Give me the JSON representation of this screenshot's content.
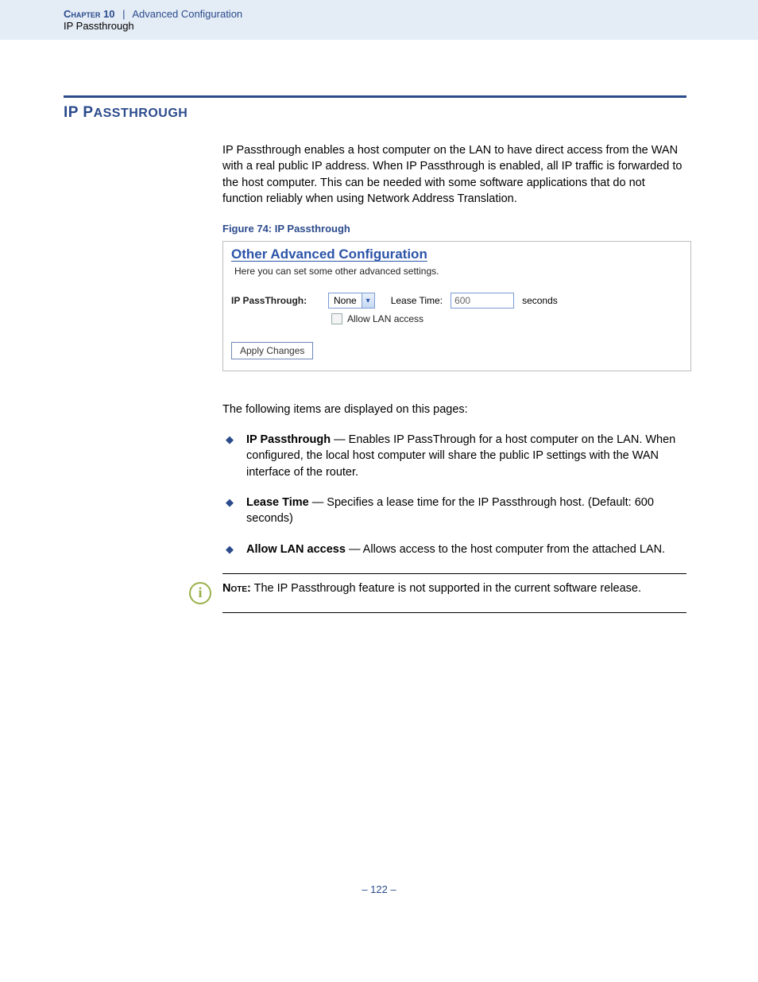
{
  "header": {
    "chapter_label": "Chapter 10",
    "separator": "|",
    "chapter_title": "Advanced Configuration",
    "sub": "IP Passthrough"
  },
  "section": {
    "title": "IP Passthrough",
    "intro": "IP Passthrough enables a host computer on the LAN to have direct access from the WAN with a real public IP address. When IP Passthrough is enabled, all IP traffic is forwarded to the host computer. This can be needed with some software applications that do not function reliably when using Network Address Translation.",
    "figure_caption": "Figure 74:  IP Passthrough"
  },
  "screenshot": {
    "panel_title": "Other Advanced Configuration",
    "panel_sub": "Here you can set some other advanced settings.",
    "ip_label": "IP PassThrough:",
    "select_value": "None",
    "lease_label": "Lease Time:",
    "lease_value": "600",
    "seconds": "seconds",
    "allow_label": "Allow LAN access",
    "apply_label": "Apply Changes"
  },
  "following": "The following items are displayed on this pages:",
  "items": [
    {
      "title": "IP Passthrough",
      "desc": " — Enables IP PassThrough for a host computer on the LAN. When configured, the local host computer will share the public IP settings with the WAN interface of the router."
    },
    {
      "title": "Lease Time",
      "desc": " — Specifies a lease time for the IP Passthrough host. (Default: 600 seconds)"
    },
    {
      "title": "Allow LAN access",
      "desc": " — Allows access to the host computer from the attached LAN."
    }
  ],
  "note": {
    "label": "Note:",
    "text": " The IP Passthrough feature is not supported in the current software release."
  },
  "page_number": "–  122  –"
}
